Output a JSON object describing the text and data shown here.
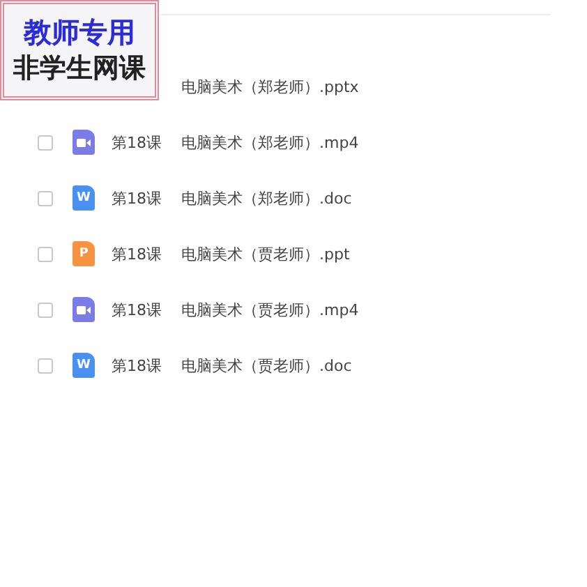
{
  "stamp": {
    "line_1": "教师专用",
    "line_2": "非学生网课"
  },
  "files": [
    {
      "name": "电脑美术（郑老师）.pptx"
    },
    {
      "kind": "video",
      "lesson": "第18课",
      "name": "电脑美术（郑老师）.mp4",
      "checked": false
    },
    {
      "kind": "word",
      "badge": "W",
      "lesson": "第18课",
      "name": "电脑美术（郑老师）.doc",
      "checked": false
    },
    {
      "kind": "ppt",
      "badge": "P",
      "lesson": "第18课",
      "name": "电脑美术（贾老师）.ppt",
      "checked": false
    },
    {
      "kind": "video",
      "lesson": "第18课",
      "name": "电脑美术（贾老师）.mp4",
      "checked": false
    },
    {
      "kind": "word",
      "badge": "W",
      "lesson": "第18课",
      "name": "电脑美术（贾老师）.doc",
      "checked": false
    }
  ]
}
